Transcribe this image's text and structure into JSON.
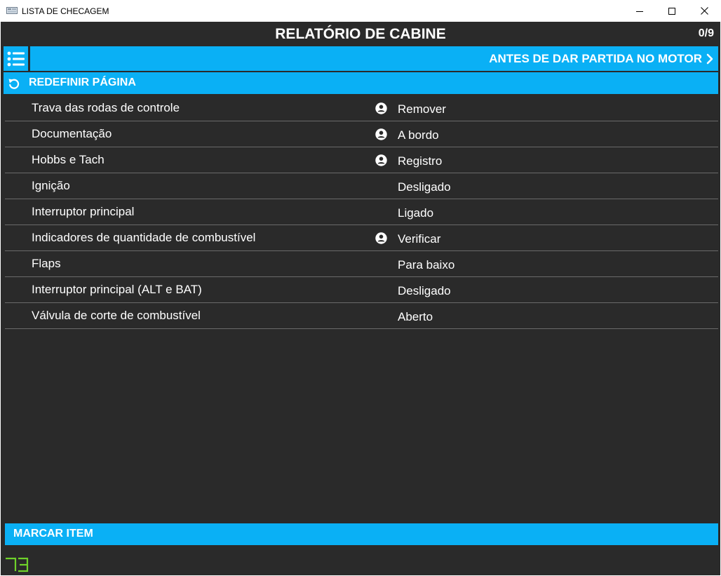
{
  "window": {
    "title": "LISTA DE CHECAGEM",
    "minimize_icon": "minimize-icon",
    "maximize_icon": "maximize-icon",
    "close_icon": "close-icon"
  },
  "header": {
    "title": "RELATÓRIO DE CABINE",
    "progress": "0/9"
  },
  "section": {
    "title": "ANTES DE DAR PARTIDA NO MOTOR",
    "menu_icon": "list-menu-icon",
    "next_icon": "chevron-right-icon"
  },
  "reset": {
    "label": "REDEFINIR PÁGINA",
    "icon": "reset-icon"
  },
  "items": [
    {
      "name": "Trava das rodas de controle",
      "action": "Remover",
      "person": true
    },
    {
      "name": "Documentação",
      "action": "A bordo",
      "person": true
    },
    {
      "name": "Hobbs e Tach",
      "action": "Registro",
      "person": true
    },
    {
      "name": "Ignição",
      "action": "Desligado",
      "person": false
    },
    {
      "name": "Interruptor principal",
      "action": "Ligado",
      "person": false
    },
    {
      "name": "Indicadores de quantidade de combustível",
      "action": "Verificar",
      "person": true
    },
    {
      "name": "Flaps",
      "action": "Para baixo",
      "person": false
    },
    {
      "name": "Interruptor principal (ALT e BAT)",
      "action": "Desligado",
      "person": false
    },
    {
      "name": "Válvula de corte de combustível",
      "action": "Aberto",
      "person": false
    }
  ],
  "footer": {
    "mark_label": "MARCAR ITEM",
    "logo_icon": "app-logo-icon"
  },
  "colors": {
    "accent": "#0ab0f5",
    "background": "#2a2a2a",
    "logo": "#6fd12a"
  }
}
